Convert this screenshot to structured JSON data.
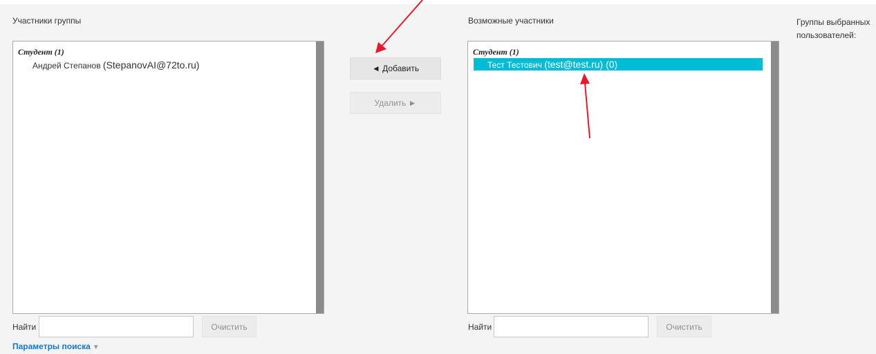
{
  "left_panel": {
    "title": "Участники группы",
    "group_label": "Студент (1)",
    "members": [
      {
        "name": "Андрей Степанов",
        "email": "(StepanovAI@72to.ru)"
      }
    ],
    "search_label": "Найти",
    "search_value": "",
    "clear_label": "Очистить",
    "search_params_label": "Параметры поиска"
  },
  "actions": {
    "add_label": "◄ Добавить",
    "remove_label": "Удалить ►"
  },
  "right_panel": {
    "title": "Возможные участники",
    "group_label": "Студент (1)",
    "candidates": [
      {
        "name": "Тест Тестович",
        "email": "(test@test.ru) (0)",
        "selected": true
      }
    ],
    "search_label": "Найти",
    "search_value": "",
    "clear_label": "Очистить"
  },
  "side_info": {
    "groups_title_line1": "Группы выбранных",
    "groups_title_line2": "пользователей:"
  },
  "colors": {
    "selection": "#00bcd4",
    "link": "#1177d1",
    "annotation_arrow": "#e8192c"
  }
}
